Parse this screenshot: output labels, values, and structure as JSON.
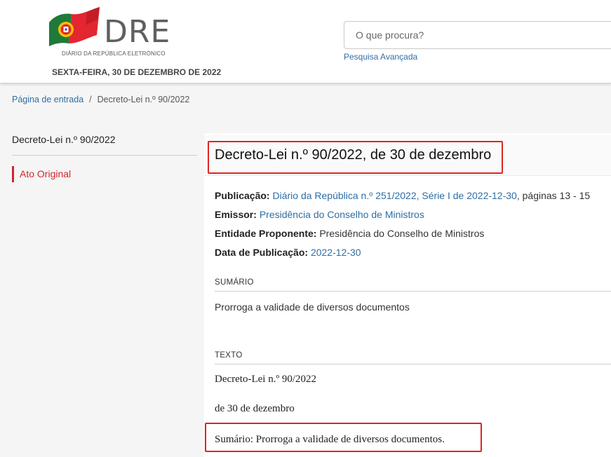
{
  "header": {
    "logo_text": "DRE",
    "logo_subtitle": "DIÁRIO DA REPÚBLICA ELETRÓNICO",
    "date": "SEXTA-FEIRA, 30 DE DEZEMBRO DE 2022",
    "search_placeholder": "O que procura?",
    "advanced_search": "Pesquisa Avançada",
    "flag_colors": {
      "green": "#1f7a3a",
      "red": "#e3262f",
      "gold": "#f2c200"
    }
  },
  "breadcrumb": {
    "home": "Página de entrada",
    "separator": "/",
    "current": "Decreto-Lei n.º 90/2022"
  },
  "sidebar": {
    "title": "Decreto-Lei n.º 90/2022",
    "item": "Ato Original",
    "accent_color": "#d6242b"
  },
  "document": {
    "title": "Decreto-Lei n.º 90/2022, de 30 de dezembro",
    "publicacao_label": "Publicação:",
    "publicacao_link": "Diário da República n.º 251/2022, Série I de 2022-12-30",
    "publicacao_pages": ", páginas 13 - 15",
    "emissor_label": "Emissor:",
    "emissor_link": "Presidência do Conselho de Ministros",
    "entidade_label": "Entidade Proponente:",
    "entidade_value": "Presidência do Conselho de Ministros",
    "data_label": "Data de Publicação:",
    "data_link": "2022-12-30",
    "sumario_heading": "SUMÁRIO",
    "sumario_text": "Prorroga a validade de diversos documentos",
    "texto_heading": "TEXTO",
    "texto_line1": "Decreto-Lei n.º 90/2022",
    "texto_line2": "de 30 de dezembro",
    "texto_line3": "Sumário: Prorroga a validade de diversos documentos."
  },
  "highlight_color": "#e02424"
}
